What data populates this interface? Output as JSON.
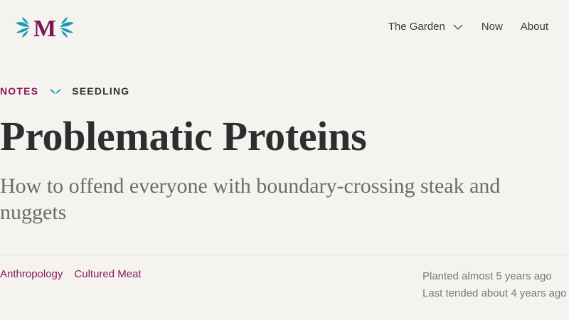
{
  "header": {
    "logo_letter": "M",
    "nav": [
      {
        "label": "The Garden",
        "has_dropdown": true
      },
      {
        "label": "Now"
      },
      {
        "label": "About"
      }
    ]
  },
  "breadcrumb": {
    "section": "NOTES",
    "stage": "SEEDLING"
  },
  "article": {
    "title": "Problematic Proteins",
    "subtitle": "How to offend everyone with boundary-crossing steak and nuggets"
  },
  "tags": [
    "Anthropology",
    "Cultured Meat"
  ],
  "dates": {
    "planted": "Planted almost 5 years ago",
    "tended": "Last tended about 4 years ago"
  },
  "colors": {
    "background": "#f5f3ef",
    "accent": "#8a1a5e",
    "leaf": "#1a9bb0",
    "text": "#2e2e2e",
    "muted": "#7a7a7a"
  },
  "icons": {
    "logo": "leaf-m-logo-icon",
    "dropdown": "chevron-down-icon",
    "growth_stage": "seedling-icon"
  }
}
